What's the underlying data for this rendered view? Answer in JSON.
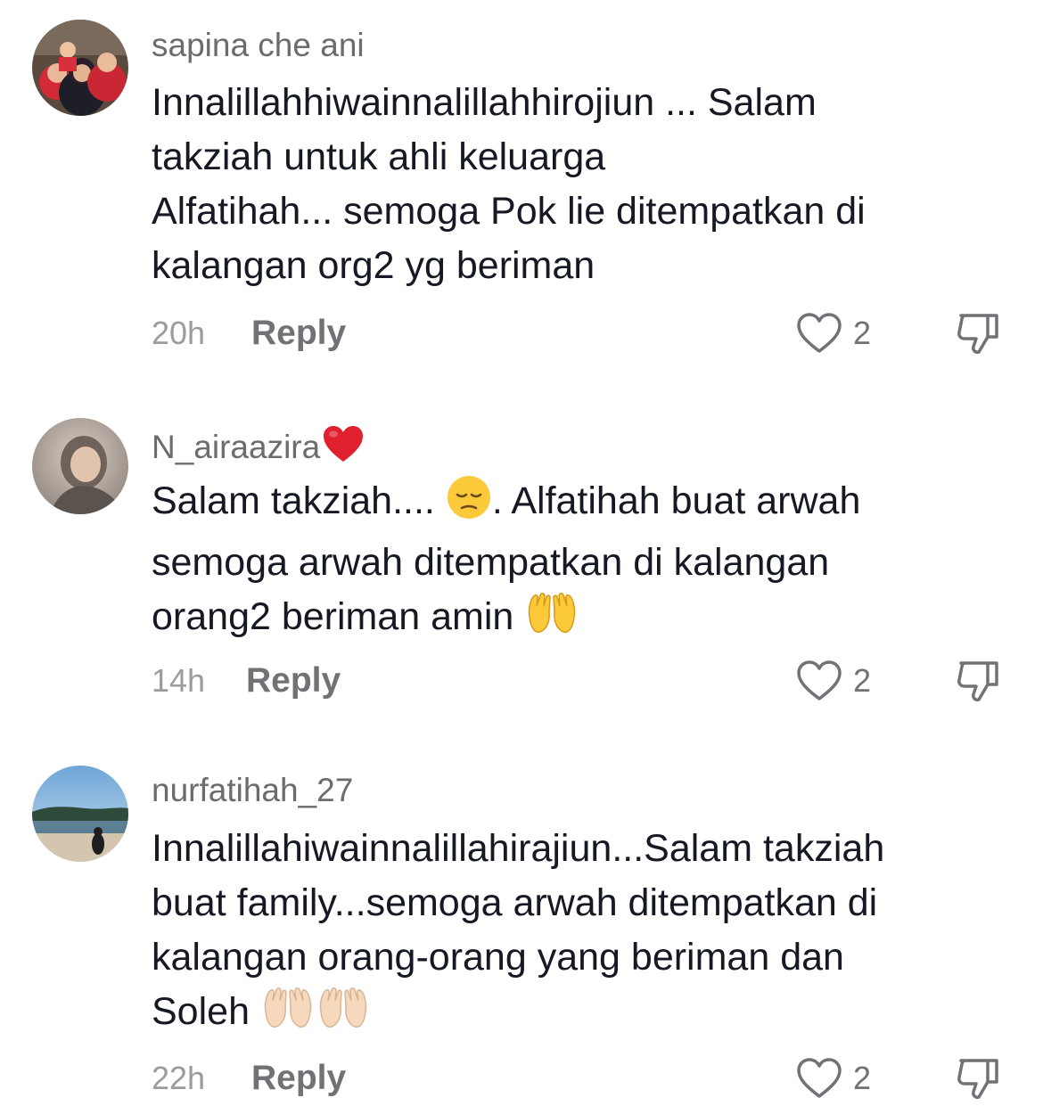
{
  "comments": [
    {
      "username": "sapina che ani",
      "text": "Innalillahhiwainnalillahhirojiun ... Salam\ntakziah untuk ahli keluarga\nAlfatihah... semoga Pok lie ditempatkan di\nkalangan org2 yg beriman",
      "time": "20h",
      "reply_label": "Reply",
      "likes": "2"
    },
    {
      "username": "N_airaazira",
      "text_part1": "Salam takziah.... ",
      "text_part2": ". Alfatihah buat arwah\nsemoga arwah ditempatkan di kalangan\norang2 beriman amin ",
      "time": "14h",
      "reply_label": "Reply",
      "likes": "2"
    },
    {
      "username": "nurfatihah_27",
      "text": "Innalillahiwainnalillahirajiun...Salam takziah\nbuat family...semoga arwah ditempatkan di\nkalangan orang-orang yang beriman dan\nSoleh ",
      "time": "22h",
      "reply_label": "Reply",
      "likes": "2"
    }
  ],
  "icons": {
    "like": "heart-outline-icon",
    "dislike": "thumbs-down-icon",
    "username_emoji": "red-heart-emoji",
    "sad_emoji": "pensive-face-emoji",
    "pray_emoji": "raising-hands-emoji"
  },
  "colors": {
    "text": "#161823",
    "muted": "#717176",
    "username": "#6b6b70",
    "heart_red": "#e0202e"
  }
}
